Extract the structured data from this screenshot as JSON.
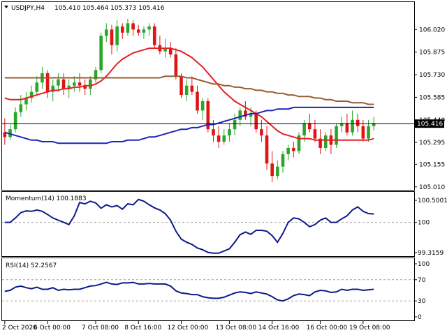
{
  "header": {
    "symbol": "USDJPY,H4",
    "ohlc": "105.410 105.464 105.373 105.416"
  },
  "momentum": {
    "title": "Momentum(14) 100.1883"
  },
  "rsi": {
    "title": "RSI(14) 52.2567"
  },
  "colors": {
    "bull": "#2aa62a",
    "bear": "#e01414",
    "ma_fast": "#e52020",
    "ma_mid": "#1f24b8",
    "ma_slow": "#9a5a32",
    "indicator": "#0c1a87",
    "border": "#000000",
    "grid": "#a0a0a0"
  },
  "chart_data": [
    {
      "type": "candlestick",
      "title": "USDJPY,H4",
      "y_ticks": [
        "106.020",
        "105.875",
        "105.730",
        "105.585",
        "105.440",
        "105.295",
        "105.155",
        "105.010"
      ],
      "ylim": [
        105.0,
        106.12
      ],
      "current_price": 105.416,
      "current_price_label": "105.416",
      "x_ticks": [
        "2 Oct 2020",
        "6 Oct 00:00",
        "7 Oct 08:00",
        "8 Oct 16:00",
        "12 Oct 00:00",
        "13 Oct 08:00",
        "14 Oct 16:00",
        "16 Oct 00:00",
        "19 Oct 08:00"
      ],
      "candles": [
        [
          105.36,
          105.45,
          105.28,
          105.33
        ],
        [
          105.33,
          105.41,
          105.31,
          105.38
        ],
        [
          105.38,
          105.52,
          105.36,
          105.49
        ],
        [
          105.49,
          105.6,
          105.46,
          105.54
        ],
        [
          105.54,
          105.62,
          105.5,
          105.58
        ],
        [
          105.58,
          105.66,
          105.55,
          105.62
        ],
        [
          105.62,
          105.72,
          105.6,
          105.68
        ],
        [
          105.68,
          105.78,
          105.64,
          105.74
        ],
        [
          105.74,
          105.76,
          105.58,
          105.62
        ],
        [
          105.62,
          105.7,
          105.56,
          105.66
        ],
        [
          105.66,
          105.74,
          105.62,
          105.7
        ],
        [
          105.7,
          105.74,
          105.6,
          105.64
        ],
        [
          105.64,
          105.7,
          105.58,
          105.66
        ],
        [
          105.66,
          105.72,
          105.62,
          105.68
        ],
        [
          105.68,
          105.74,
          105.62,
          105.66
        ],
        [
          105.66,
          105.7,
          105.6,
          105.64
        ],
        [
          105.64,
          105.72,
          105.6,
          105.7
        ],
        [
          105.7,
          105.78,
          105.68,
          105.76
        ],
        [
          105.76,
          106.0,
          105.74,
          105.98
        ],
        [
          105.98,
          106.06,
          105.94,
          106.02
        ],
        [
          106.02,
          106.05,
          105.86,
          105.92
        ],
        [
          105.92,
          106.08,
          105.88,
          106.04
        ],
        [
          106.04,
          106.06,
          105.96,
          106.0
        ],
        [
          106.0,
          106.09,
          105.98,
          106.06
        ],
        [
          106.06,
          106.08,
          105.98,
          106.02
        ],
        [
          106.02,
          106.05,
          105.98,
          106.0
        ],
        [
          106.0,
          106.04,
          105.96,
          106.02
        ],
        [
          106.02,
          106.06,
          105.98,
          106.04
        ],
        [
          106.04,
          106.06,
          105.9,
          105.92
        ],
        [
          105.92,
          105.98,
          105.86,
          105.88
        ],
        [
          105.88,
          105.96,
          105.84,
          105.9
        ],
        [
          105.9,
          105.94,
          105.84,
          105.86
        ],
        [
          105.86,
          105.9,
          105.7,
          105.72
        ],
        [
          105.72,
          105.74,
          105.58,
          105.6
        ],
        [
          105.6,
          105.7,
          105.56,
          105.66
        ],
        [
          105.66,
          105.72,
          105.6,
          105.62
        ],
        [
          105.62,
          105.66,
          105.48,
          105.5
        ],
        [
          105.5,
          105.58,
          105.44,
          105.56
        ],
        [
          105.56,
          105.58,
          105.36,
          105.38
        ],
        [
          105.38,
          105.44,
          105.3,
          105.34
        ],
        [
          105.34,
          105.4,
          105.26,
          105.3
        ],
        [
          105.3,
          105.38,
          105.28,
          105.34
        ],
        [
          105.34,
          105.42,
          105.3,
          105.38
        ],
        [
          105.38,
          105.48,
          105.34,
          105.44
        ],
        [
          105.44,
          105.52,
          105.4,
          105.5
        ],
        [
          105.5,
          105.56,
          105.44,
          105.46
        ],
        [
          105.46,
          105.52,
          105.4,
          105.48
        ],
        [
          105.48,
          105.5,
          105.36,
          105.38
        ],
        [
          105.38,
          105.44,
          105.3,
          105.34
        ],
        [
          105.34,
          105.4,
          105.12,
          105.16
        ],
        [
          105.16,
          105.24,
          105.04,
          105.08
        ],
        [
          105.08,
          105.18,
          105.06,
          105.14
        ],
        [
          105.14,
          105.24,
          105.1,
          105.22
        ],
        [
          105.22,
          105.28,
          105.18,
          105.26
        ],
        [
          105.26,
          105.3,
          105.2,
          105.24
        ],
        [
          105.24,
          105.36,
          105.22,
          105.34
        ],
        [
          105.34,
          105.44,
          105.3,
          105.42
        ],
        [
          105.42,
          105.48,
          105.36,
          105.38
        ],
        [
          105.38,
          105.44,
          105.3,
          105.32
        ],
        [
          105.32,
          105.38,
          105.22,
          105.26
        ],
        [
          105.26,
          105.36,
          105.24,
          105.34
        ],
        [
          105.34,
          105.38,
          105.22,
          105.28
        ],
        [
          105.28,
          105.42,
          105.26,
          105.4
        ],
        [
          105.4,
          105.46,
          105.36,
          105.42
        ],
        [
          105.42,
          105.48,
          105.34,
          105.36
        ],
        [
          105.36,
          105.5,
          105.34,
          105.44
        ],
        [
          105.44,
          105.48,
          105.36,
          105.4
        ],
        [
          105.4,
          105.44,
          105.3,
          105.32
        ],
        [
          105.32,
          105.44,
          105.3,
          105.4
        ],
        [
          105.4,
          105.46,
          105.37,
          105.42
        ]
      ],
      "series": [
        {
          "values": [
            105.58,
            105.57,
            105.57,
            105.57,
            105.58,
            105.59,
            105.6,
            105.61,
            105.62,
            105.63,
            105.63,
            105.64,
            105.64,
            105.65,
            105.65,
            105.66,
            105.66,
            105.67,
            105.69,
            105.72,
            105.76,
            105.8,
            105.83,
            105.85,
            105.87,
            105.88,
            105.89,
            105.9,
            105.9,
            105.9,
            105.9,
            105.9,
            105.89,
            105.88,
            105.86,
            105.84,
            105.81,
            105.78,
            105.74,
            105.7,
            105.66,
            105.62,
            105.59,
            105.56,
            105.54,
            105.52,
            105.5,
            105.48,
            105.46,
            105.43,
            105.4,
            105.37,
            105.35,
            105.34,
            105.33,
            105.32,
            105.32,
            105.32,
            105.31,
            105.31,
            105.31,
            105.31,
            105.31,
            105.31,
            105.31,
            105.31,
            105.31,
            105.31,
            105.31,
            105.32
          ]
        },
        {
          "values": [
            105.36,
            105.35,
            105.34,
            105.33,
            105.32,
            105.31,
            105.31,
            105.3,
            105.3,
            105.3,
            105.29,
            105.29,
            105.29,
            105.29,
            105.29,
            105.29,
            105.29,
            105.29,
            105.29,
            105.29,
            105.3,
            105.3,
            105.3,
            105.31,
            105.31,
            105.31,
            105.32,
            105.33,
            105.33,
            105.34,
            105.35,
            105.36,
            105.37,
            105.38,
            105.38,
            105.39,
            105.39,
            105.4,
            105.41,
            105.41,
            105.42,
            105.43,
            105.44,
            105.45,
            105.46,
            105.47,
            105.48,
            105.48,
            105.49,
            105.5,
            105.5,
            105.51,
            105.51,
            105.51,
            105.52,
            105.52,
            105.52,
            105.52,
            105.52,
            105.52,
            105.52,
            105.52,
            105.52,
            105.52,
            105.52,
            105.52,
            105.52,
            105.52,
            105.52,
            105.52
          ]
        },
        {
          "values": [
            105.71,
            105.71,
            105.71,
            105.71,
            105.71,
            105.71,
            105.71,
            105.71,
            105.71,
            105.71,
            105.71,
            105.71,
            105.71,
            105.71,
            105.71,
            105.71,
            105.71,
            105.71,
            105.71,
            105.71,
            105.71,
            105.71,
            105.71,
            105.71,
            105.71,
            105.71,
            105.71,
            105.71,
            105.71,
            105.71,
            105.72,
            105.72,
            105.72,
            105.72,
            105.71,
            105.71,
            105.7,
            105.69,
            105.68,
            105.67,
            105.67,
            105.66,
            105.66,
            105.65,
            105.65,
            105.64,
            105.64,
            105.63,
            105.63,
            105.62,
            105.62,
            105.61,
            105.61,
            105.6,
            105.6,
            105.59,
            105.59,
            105.59,
            105.58,
            105.58,
            105.57,
            105.57,
            105.56,
            105.56,
            105.56,
            105.55,
            105.55,
            105.55,
            105.54,
            105.54
          ]
        }
      ]
    },
    {
      "type": "line",
      "title": "Momentum(14) 100.1883",
      "y_ticks": [
        "100.5001",
        "100",
        "99.3159"
      ],
      "ylim": [
        99.25,
        100.58
      ],
      "reference_line": 100.0,
      "values": [
        100.0,
        100.0,
        100.1,
        100.22,
        100.26,
        100.25,
        100.28,
        100.25,
        100.18,
        100.1,
        100.05,
        100.0,
        99.95,
        100.15,
        100.45,
        100.42,
        100.48,
        100.44,
        100.32,
        100.4,
        100.35,
        100.38,
        100.3,
        100.42,
        100.4,
        100.52,
        100.48,
        100.4,
        100.33,
        100.28,
        100.2,
        100.05,
        99.8,
        99.62,
        99.55,
        99.5,
        99.42,
        99.38,
        99.32,
        99.3,
        99.3,
        99.35,
        99.4,
        99.55,
        99.72,
        99.78,
        99.73,
        99.82,
        99.82,
        99.8,
        99.7,
        99.55,
        99.75,
        100.0,
        100.1,
        100.08,
        100.0,
        99.9,
        99.95,
        100.05,
        100.1,
        100.0,
        100.0,
        100.08,
        100.15,
        100.28,
        100.35,
        100.25,
        100.2,
        100.19
      ]
    },
    {
      "type": "line",
      "title": "RSI(14) 52.2567",
      "y_ticks": [
        "100",
        "70",
        "30",
        "0"
      ],
      "ylim": [
        0,
        100
      ],
      "reference_lines": [
        70,
        30
      ],
      "values": [
        48,
        50,
        56,
        58,
        55,
        53,
        56,
        52,
        52,
        55,
        50,
        52,
        51,
        52,
        52,
        55,
        58,
        59,
        62,
        65,
        62,
        61,
        64,
        64,
        65,
        62,
        62,
        63,
        62,
        62,
        62,
        58,
        49,
        45,
        44,
        42,
        42,
        38,
        36,
        35,
        35,
        37,
        41,
        45,
        47,
        46,
        44,
        47,
        45,
        43,
        38,
        32,
        30,
        34,
        40,
        43,
        42,
        40,
        47,
        50,
        49,
        46,
        47,
        52,
        50,
        52,
        52,
        50,
        51,
        52
      ]
    }
  ]
}
